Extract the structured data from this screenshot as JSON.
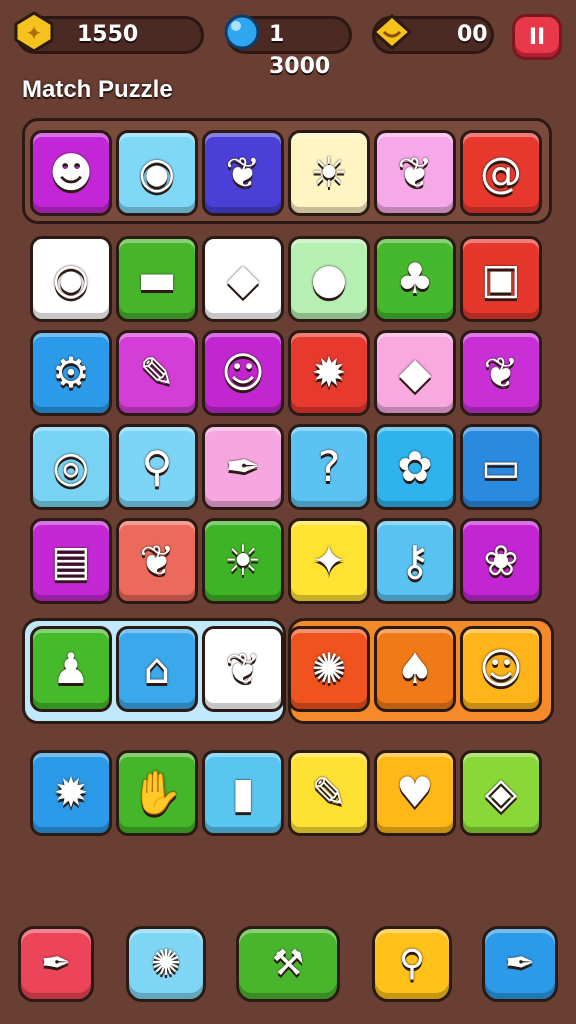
{
  "hud": {
    "coins": "1550",
    "gems": "1 3000",
    "stars": "00",
    "pause_label": "II"
  },
  "title": "Match Puzzle",
  "rows": [
    [
      {
        "icon": "robot-icon",
        "color": "#c326d6",
        "glyph": "☻"
      },
      {
        "icon": "camera-icon",
        "color": "#7fd8f6",
        "glyph": "◉"
      },
      {
        "icon": "leaf-icon",
        "color": "#4a3fd6",
        "glyph": "❦"
      },
      {
        "icon": "sun-icon",
        "color": "#fff4c2",
        "glyph": "☀"
      },
      {
        "icon": "leaf-icon",
        "color": "#f6a9e8",
        "glyph": "❦"
      },
      {
        "icon": "swirl-icon",
        "color": "#e8382e",
        "glyph": "@"
      }
    ],
    [
      {
        "icon": "camera-icon",
        "color": "#ffffff",
        "glyph": "◉"
      },
      {
        "icon": "car-icon",
        "color": "#47b52b",
        "glyph": "▬"
      },
      {
        "icon": "shield-icon",
        "color": "#ffffff",
        "glyph": "◆"
      },
      {
        "icon": "fruit-icon",
        "color": "#b6efb2",
        "glyph": "●"
      },
      {
        "icon": "tree-icon",
        "color": "#46b82f",
        "glyph": "♣"
      },
      {
        "icon": "machine-icon",
        "color": "#e6372d",
        "glyph": "▣"
      }
    ],
    [
      {
        "icon": "scooter-icon",
        "color": "#2b9ae8",
        "glyph": "⚙"
      },
      {
        "icon": "pencil-icon",
        "color": "#d33fd6",
        "glyph": "✎"
      },
      {
        "icon": "face-icon",
        "color": "#c226d1",
        "glyph": "☺"
      },
      {
        "icon": "gear-icon",
        "color": "#e7392d",
        "glyph": "✹"
      },
      {
        "icon": "gem-icon",
        "color": "#f8a9df",
        "glyph": "◆"
      },
      {
        "icon": "leaf-icon",
        "color": "#c830d6",
        "glyph": "❦"
      }
    ],
    [
      {
        "icon": "target-icon",
        "color": "#78d2f3",
        "glyph": "◎"
      },
      {
        "icon": "thermometer-icon",
        "color": "#7cd4f6",
        "glyph": "⚲"
      },
      {
        "icon": "feather-icon",
        "color": "#f7a7df",
        "glyph": "✒"
      },
      {
        "icon": "question-icon",
        "color": "#5bc3f3",
        "glyph": "?"
      },
      {
        "icon": "wheel-icon",
        "color": "#2eb3ec",
        "glyph": "✿"
      },
      {
        "icon": "radio-icon",
        "color": "#2a8ae0",
        "glyph": "▭"
      }
    ],
    [
      {
        "icon": "jar-icon",
        "color": "#c328d4",
        "glyph": "▤"
      },
      {
        "icon": "leaf-icon",
        "color": "#ec6a5c",
        "glyph": "❦"
      },
      {
        "icon": "sun-icon",
        "color": "#3fb326",
        "glyph": "☀"
      },
      {
        "icon": "popsicle-icon",
        "color": "#ffe232",
        "glyph": "✦"
      },
      {
        "icon": "key-icon",
        "color": "#58c3f1",
        "glyph": "⚷"
      },
      {
        "icon": "cat-icon",
        "color": "#c226d2",
        "glyph": "❀"
      }
    ],
    [
      {
        "icon": "monster-icon",
        "color": "#45ba2b",
        "glyph": "♟"
      },
      {
        "icon": "house-icon",
        "color": "#3aa8ea",
        "glyph": "⌂"
      },
      {
        "icon": "leaf-icon",
        "color": "#ffffff",
        "glyph": "❦"
      },
      {
        "icon": "burst-icon",
        "color": "#f0531e",
        "glyph": "✺"
      },
      {
        "icon": "drop-icon",
        "color": "#f07a18",
        "glyph": "♠"
      },
      {
        "icon": "ring-face-icon",
        "color": "#ffb41a",
        "glyph": "☺"
      }
    ],
    [
      {
        "icon": "gear-icon",
        "color": "#2b9ae8",
        "glyph": "✹"
      },
      {
        "icon": "hand-icon",
        "color": "#45b52a",
        "glyph": "✋"
      },
      {
        "icon": "battery-icon",
        "color": "#58c6f1",
        "glyph": "▮"
      },
      {
        "icon": "carrot-icon",
        "color": "#ffe133",
        "glyph": "✎"
      },
      {
        "icon": "strawberry-icon",
        "color": "#ffb818",
        "glyph": "♥"
      },
      {
        "icon": "gamepad-icon",
        "color": "#8ad838",
        "glyph": "◈"
      }
    ]
  ],
  "tools": [
    {
      "icon": "pen-icon",
      "color": "#ec4458",
      "glyph": "✒"
    },
    {
      "icon": "crab-icon",
      "color": "#7fd6f4",
      "glyph": "✺"
    },
    {
      "icon": "toolbox-icon",
      "color": "#49b52c",
      "glyph": "⚒"
    },
    {
      "icon": "magnifier-icon",
      "color": "#ffc11a",
      "glyph": "⚲"
    },
    {
      "icon": "feather-icon",
      "color": "#2b9ae8",
      "glyph": "✒"
    }
  ]
}
